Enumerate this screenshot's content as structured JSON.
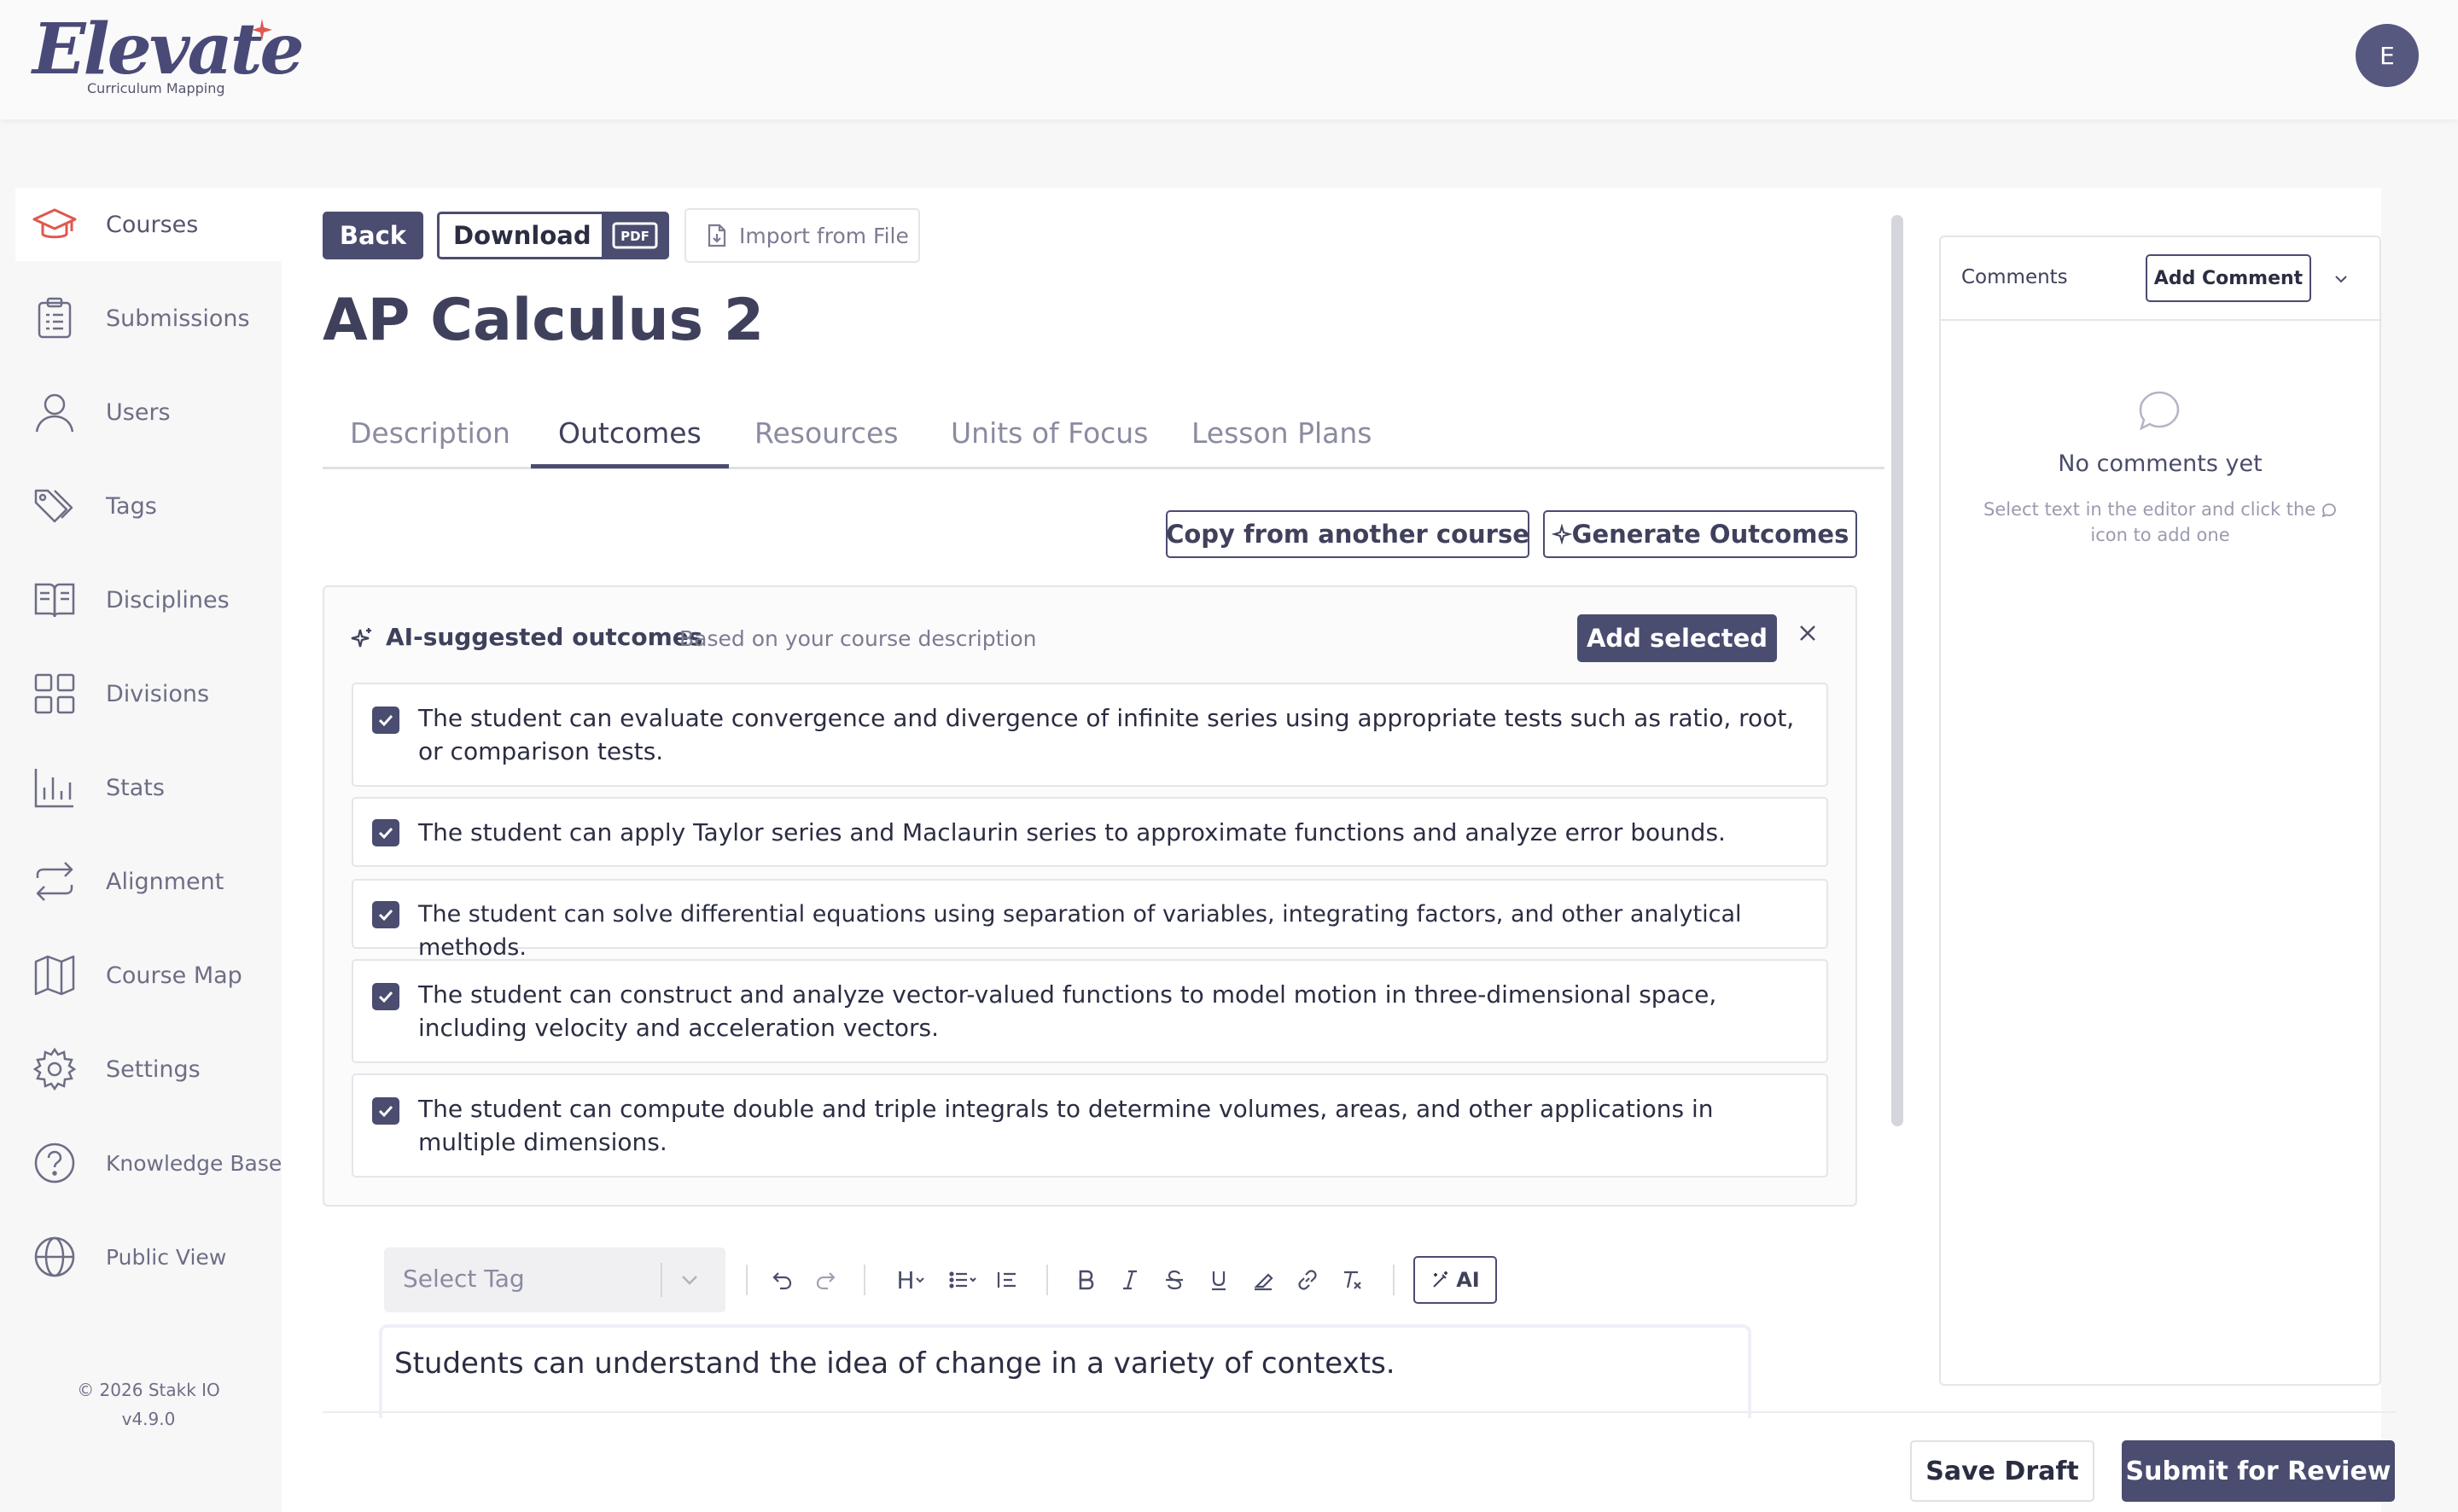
{
  "app": {
    "logo_text": "Elevate",
    "logo_subtitle": "Curriculum Mapping",
    "avatar_initial": "E",
    "brand_color": "#4a4c70"
  },
  "sidebar": {
    "items": [
      {
        "label": "Courses",
        "icon": "graduation-cap-icon",
        "active": true
      },
      {
        "label": "Submissions",
        "icon": "clipboard-list-icon"
      },
      {
        "label": "Users",
        "icon": "user-icon"
      },
      {
        "label": "Tags",
        "icon": "tags-icon"
      },
      {
        "label": "Disciplines",
        "icon": "open-book-icon"
      },
      {
        "label": "Divisions",
        "icon": "grid-icon"
      },
      {
        "label": "Stats",
        "icon": "bar-chart-icon"
      },
      {
        "label": "Alignment",
        "icon": "repeat-arrows-icon"
      },
      {
        "label": "Course Map",
        "icon": "map-icon"
      },
      {
        "label": "Settings",
        "icon": "gear-icon"
      },
      {
        "label": "Knowledge Base",
        "icon": "help-circle-icon"
      },
      {
        "label": "Public View",
        "icon": "globe-icon"
      }
    ],
    "copyright": "© 2026 Stakk IO",
    "version": "v4.9.0"
  },
  "toolbar": {
    "back_label": "Back",
    "download_label": "Download",
    "pdf_badge": "PDF",
    "import_label": "Import from File"
  },
  "course": {
    "title": "AP Calculus 2"
  },
  "tabs": [
    {
      "label": "Description"
    },
    {
      "label": "Outcomes",
      "active": true
    },
    {
      "label": "Resources"
    },
    {
      "label": "Units of Focus"
    },
    {
      "label": "Lesson Plans"
    }
  ],
  "actions": {
    "copy_label": "Copy from another course",
    "generate_label": "Generate Outcomes"
  },
  "ai_suggestions": {
    "title": "AI-suggested outcomes",
    "subtitle": "Based on your course description",
    "add_selected_label": "Add selected",
    "outcomes": [
      {
        "text": "The student can evaluate convergence and divergence of infinite series using appropriate tests such as ratio, root, or comparison tests.",
        "checked": true
      },
      {
        "text": "The student can apply Taylor series and Maclaurin series to approximate functions and analyze error bounds.",
        "checked": true
      },
      {
        "text": "The student can solve differential equations using separation of variables, integrating factors, and other analytical methods.",
        "checked": true
      },
      {
        "text": "The student can construct and analyze vector-valued functions to model motion in three-dimensional space, including velocity and acceleration vectors.",
        "checked": true
      },
      {
        "text": "The student can compute double and triple integrals to determine volumes, areas, and other applications in multiple dimensions.",
        "checked": true
      }
    ]
  },
  "editor": {
    "tag_placeholder": "Select Tag",
    "heading_label": "H",
    "ai_label": "AI",
    "content": "Students can understand the idea of change in a variety of contexts."
  },
  "comments": {
    "label": "Comments",
    "add_label": "Add Comment",
    "empty_title": "No comments yet",
    "empty_hint_1": "Select text in the editor and click the",
    "empty_hint_2": "icon to add one"
  },
  "footer": {
    "save_label": "Save Draft",
    "submit_label": "Submit for Review"
  }
}
